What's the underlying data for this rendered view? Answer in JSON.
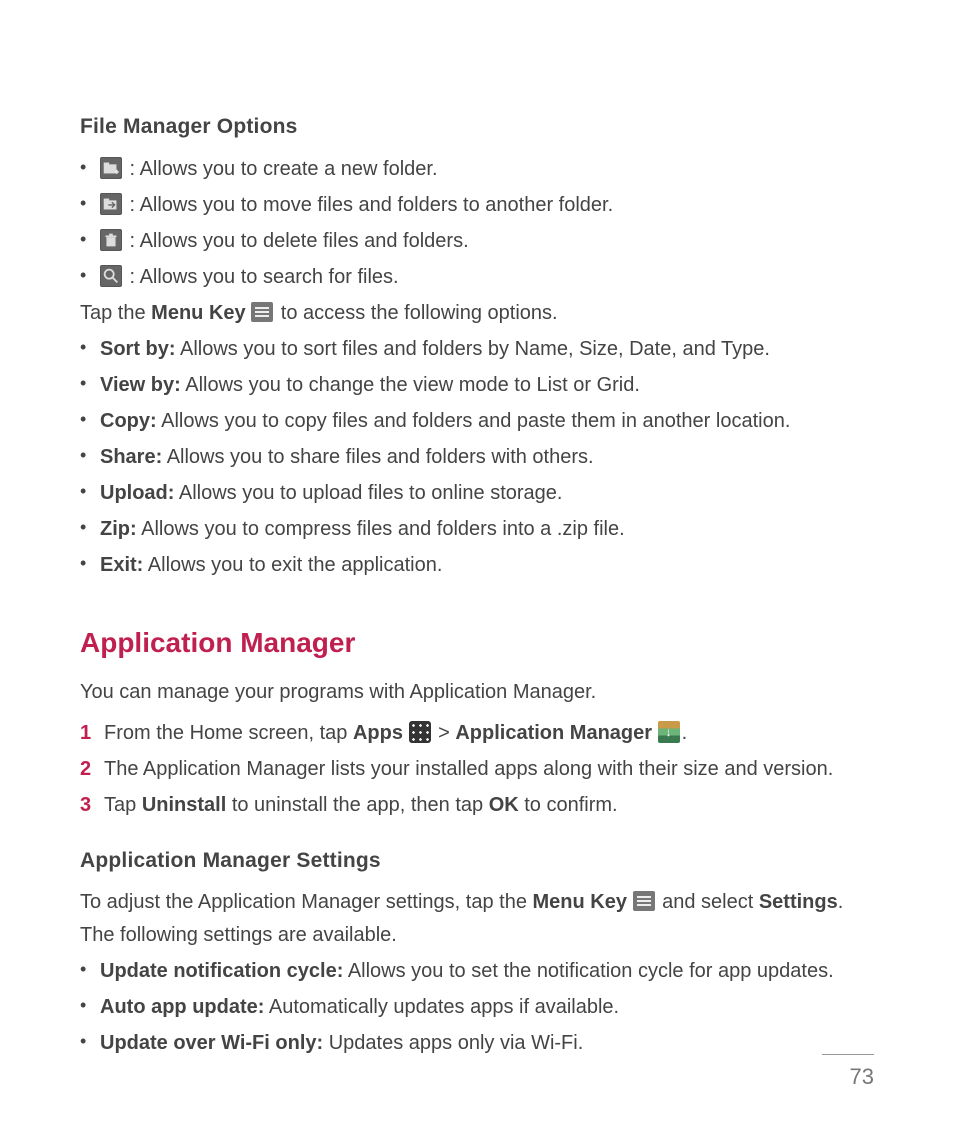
{
  "page_number": "73",
  "section1": {
    "heading": "File Manager Options",
    "iconItems": [
      {
        "icon": "new-folder-icon",
        "text": " : Allows you to create a new folder."
      },
      {
        "icon": "move-icon",
        "text": " : Allows you to move files and folders to another folder."
      },
      {
        "icon": "delete-icon",
        "text": " : Allows you to delete files and folders."
      },
      {
        "icon": "search-icon",
        "text": " : Allows you to search for files."
      }
    ],
    "tapLine": {
      "prefix": "Tap the ",
      "bold": "Menu Key",
      "suffix": " to access the following options."
    },
    "menuItems": [
      {
        "label": "Sort by:",
        "text": " Allows you to sort files and folders by Name, Size, Date, and Type."
      },
      {
        "label": "View by:",
        "text": " Allows you to change the view mode to List or Grid."
      },
      {
        "label": "Copy:",
        "text": " Allows you to copy files and folders and paste them in another location."
      },
      {
        "label": "Share:",
        "text": " Allows you to share files and folders with others."
      },
      {
        "label": "Upload:",
        "text": " Allows you to upload files to online storage."
      },
      {
        "label": "Zip:",
        "text": " Allows you to compress files and folders into a .zip file."
      },
      {
        "label": "Exit:",
        "text": " Allows you to exit the application."
      }
    ]
  },
  "section2": {
    "heading": "Application Manager",
    "intro": "You can manage your programs with Application Manager.",
    "steps": {
      "s1": {
        "a": "From the Home screen, tap ",
        "b1": "Apps",
        "mid": " > ",
        "b2": "Application Manager",
        "end": "."
      },
      "s2": "The Application Manager lists your installed apps along with their size and version.",
      "s3": {
        "a": "Tap ",
        "b1": "Uninstall",
        "mid": " to uninstall the app, then tap ",
        "b2": "OK",
        "end": " to confirm."
      }
    },
    "sub": {
      "heading": "Application Manager Settings",
      "introParts": {
        "a": "To adjust the Application Manager settings, tap the ",
        "b1": "Menu Key",
        "mid": " and select ",
        "b2": "Settings",
        "end": ". The following settings are available."
      },
      "items": [
        {
          "label": "Update notification cycle:",
          "text": " Allows you to set the notification cycle for app updates."
        },
        {
          "label": "Auto app update:",
          "text": " Automatically updates apps if available."
        },
        {
          "label": "Update over Wi-Fi only:",
          "text": " Updates apps only via Wi-Fi."
        }
      ]
    }
  }
}
